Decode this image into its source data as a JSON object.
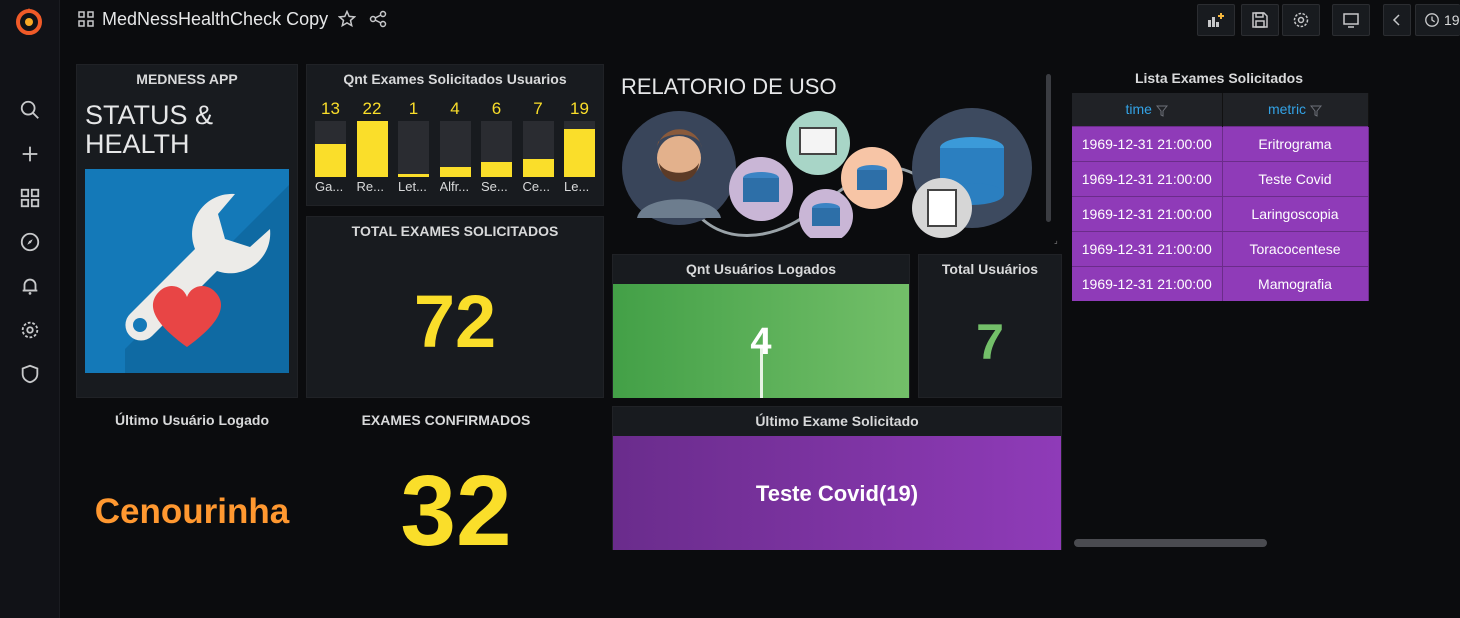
{
  "app": {
    "dashboard_title": "MedNessHealthCheck Copy",
    "time_range_fragment": "19"
  },
  "sidebar": {
    "icons": [
      "grafana-logo-icon",
      "search-icon",
      "plus-icon",
      "dashboards-icon",
      "explore-icon",
      "alert-bell-icon",
      "gear-icon",
      "shield-icon"
    ]
  },
  "toolbar": {
    "icons": [
      "add-panel-icon",
      "save-icon",
      "settings-icon",
      "tv-mode-icon",
      "chevron-left-icon",
      "clock-icon"
    ]
  },
  "panels": {
    "medness_app": {
      "title": "MEDNESS APP",
      "heading_line1": "STATUS &",
      "heading_line2": "HEALTH"
    },
    "qnt_exames": {
      "title": "Qnt Exames Solicitados Usuarios",
      "bar_color": "#fade2a"
    },
    "relatorio": {
      "title": "RELATORIO DE USO"
    },
    "lista_exames": {
      "title": "Lista Exames Solicitados",
      "col_time": "time",
      "col_metric": "metric"
    },
    "total_exames": {
      "title": "TOTAL EXAMES SOLICITADOS",
      "value": "72"
    },
    "qnt_usuarios_logados": {
      "title": "Qnt Usuários Logados",
      "value": "4"
    },
    "total_usuarios": {
      "title": "Total Usuários",
      "value": "7"
    },
    "ultimo_usuario": {
      "title": "Último Usuário Logado",
      "value": "Cenourinha"
    },
    "exames_confirmados": {
      "title": "EXAMES CONFIRMADOS",
      "value": "32"
    },
    "ultimo_exame": {
      "title": "Último Exame Solicitado",
      "value": "Teste Covid(19)"
    }
  },
  "chart_data": {
    "type": "bar",
    "categories": [
      "Ga...",
      "Re...",
      "Let...",
      "Alfr...",
      "Se...",
      "Ce...",
      "Le..."
    ],
    "values": [
      13,
      22,
      1,
      4,
      6,
      7,
      19
    ],
    "ylim": [
      0,
      22
    ]
  },
  "table": {
    "rows": [
      {
        "time": "1969-12-31 21:00:00",
        "metric": "Eritrograma"
      },
      {
        "time": "1969-12-31 21:00:00",
        "metric": "Teste Covid"
      },
      {
        "time": "1969-12-31 21:00:00",
        "metric": "Laringoscopia"
      },
      {
        "time": "1969-12-31 21:00:00",
        "metric": "Toracocentese"
      },
      {
        "time": "1969-12-31 21:00:00",
        "metric": "Mamografia"
      }
    ]
  },
  "colors": {
    "yellow": "#fade2a",
    "orange": "#ff9830",
    "green": "#73bf69",
    "purple": "#8f3bb8",
    "blue": "#33a2e5"
  }
}
